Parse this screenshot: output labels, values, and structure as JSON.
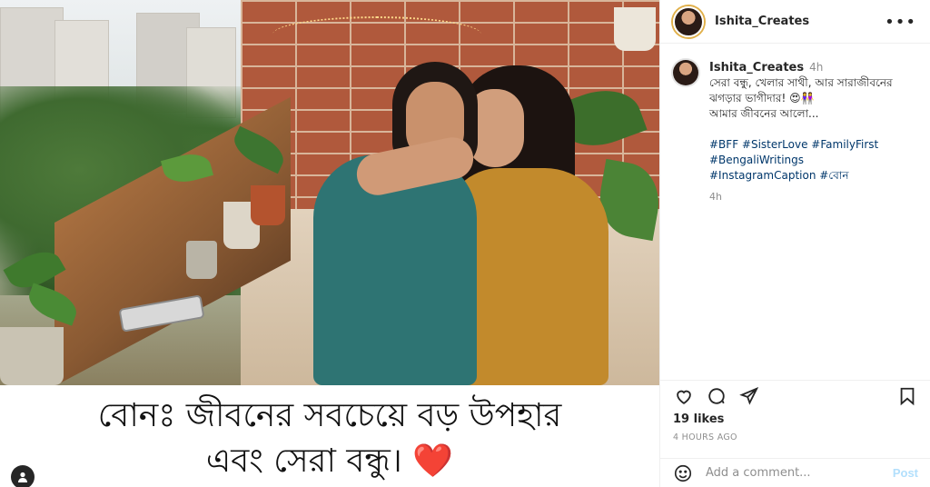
{
  "post": {
    "author": "Ishita_Creates",
    "more_icon": "more-horizontal-icon"
  },
  "media": {
    "overlay_line1": "বোনঃ জীবনের সবচেয়ে বড় উপহার",
    "overlay_line2": "এবং সেরা বন্ধু।",
    "overlay_emoji": "❤️",
    "tag_icon": "user-tag-icon"
  },
  "caption": {
    "username": "Ishita_Creates",
    "time": "4h",
    "line1": "সেরা বন্ধু, খেলার সাথী, আর সারাজীবনের",
    "line2": "ঝগড়ার ভাগীদার! 😍👭",
    "line3": "আমার জীবনের আলো...",
    "hashtags_line1": "#BFF #SisterLove #FamilyFirst",
    "hashtags_line2": "#BengaliWritings",
    "hashtags_line3": "#InstagramCaption #বোন",
    "age": "4h"
  },
  "actions": {
    "like_icon": "heart-icon",
    "comment_icon": "comment-icon",
    "share_icon": "share-icon",
    "save_icon": "bookmark-icon"
  },
  "stats": {
    "likes": "19 likes",
    "posted": "4 HOURS AGO"
  },
  "comment": {
    "placeholder": "Add a comment...",
    "post_label": "Post",
    "emoji_icon": "emoji-icon"
  },
  "colors": {
    "link": "#00376b",
    "muted": "#8e8e8e",
    "post_disabled": "#b2dffc",
    "text": "#262626"
  }
}
